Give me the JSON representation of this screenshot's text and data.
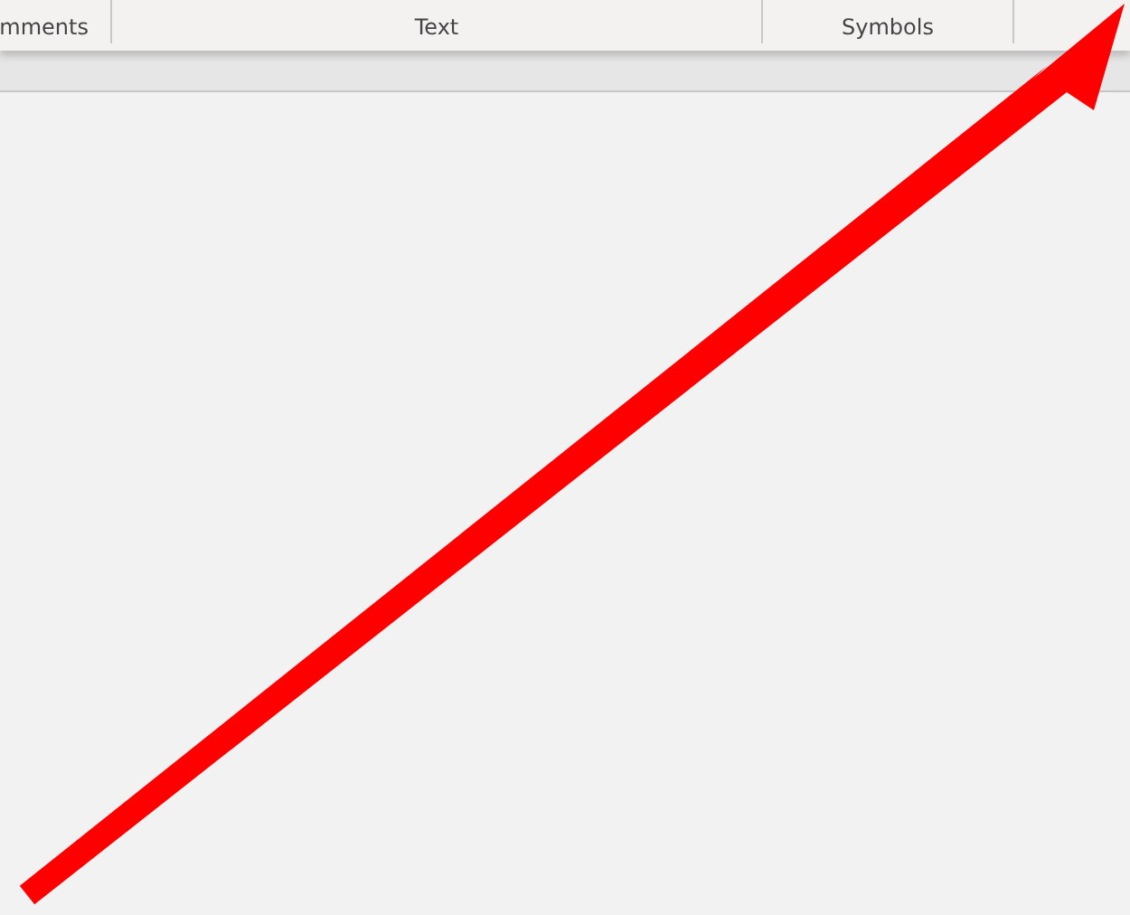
{
  "ribbon": {
    "groups": [
      {
        "label": "mments"
      },
      {
        "label": "Text"
      },
      {
        "label": "Symbols"
      }
    ]
  }
}
